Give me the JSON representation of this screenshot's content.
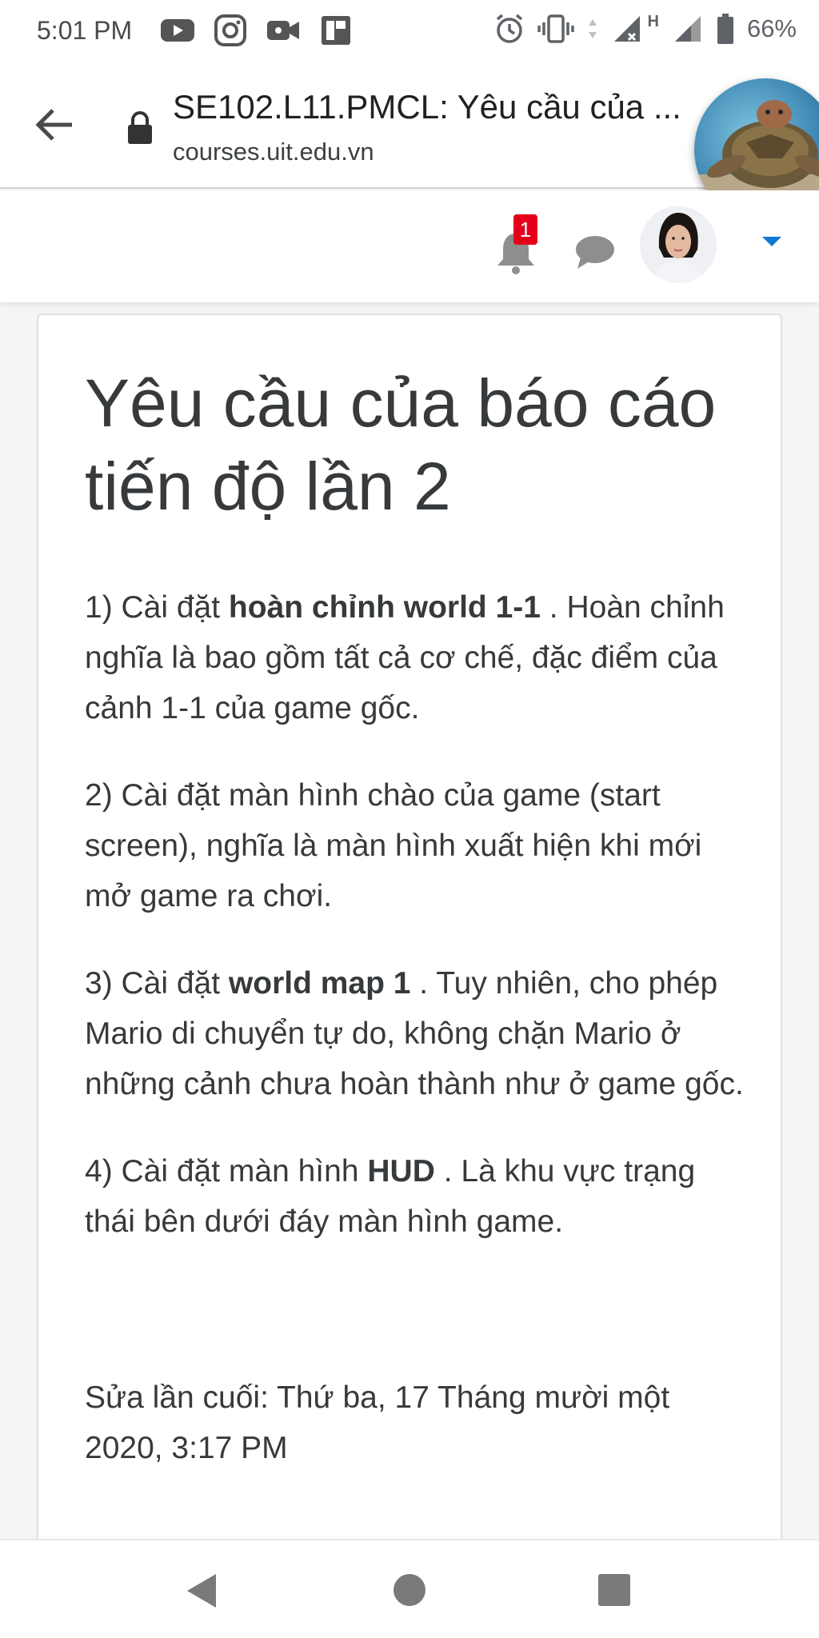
{
  "status_bar": {
    "time": "5:01 PM",
    "battery": "66%",
    "network": "H",
    "app_icons": [
      "youtube-icon",
      "instagram-icon",
      "video-camera-icon",
      "flipboard-icon"
    ],
    "system_icons": [
      "alarm-icon",
      "vibrate-icon",
      "signal-x-icon",
      "signal-icon",
      "battery-icon"
    ]
  },
  "browser": {
    "tab_title": "SE102.L11.PMCL: Yêu cầu của ...",
    "url": "courses.uit.edu.vn"
  },
  "moodle_nav": {
    "notification_count": "1"
  },
  "page": {
    "heading": "Yêu cầu của báo cáo tiến độ lần 2",
    "items": [
      {
        "before": "1) Cài đặt ",
        "bold": "hoàn chỉnh world 1-1",
        "after": " . Hoàn chỉnh nghĩa là bao gồm tất cả cơ chế, đặc điểm của cảnh 1-1 của game gốc."
      },
      {
        "before": "2) Cài đặt màn hình chào của game (start screen), nghĩa là màn hình xuất hiện khi mới mở game ra chơi.",
        "bold": "",
        "after": ""
      },
      {
        "before": "3) Cài đặt ",
        "bold": "world map 1",
        "after": " . Tuy nhiên, cho phép Mario di chuyển tự do, không chặn Mario ở những cảnh chưa hoàn thành như ở game gốc."
      },
      {
        "before": "4) Cài đặt màn hình ",
        "bold": "HUD",
        "after": " . Là khu vực trạng thái bên dưới đáy màn hình game."
      }
    ],
    "last_modified": "Sửa lần cuối: Thứ ba, 17 Tháng mười một 2020, 3:17 PM"
  },
  "colors": {
    "badge": "#e4001b",
    "caret": "#1177d1",
    "text": "#373a3c"
  }
}
